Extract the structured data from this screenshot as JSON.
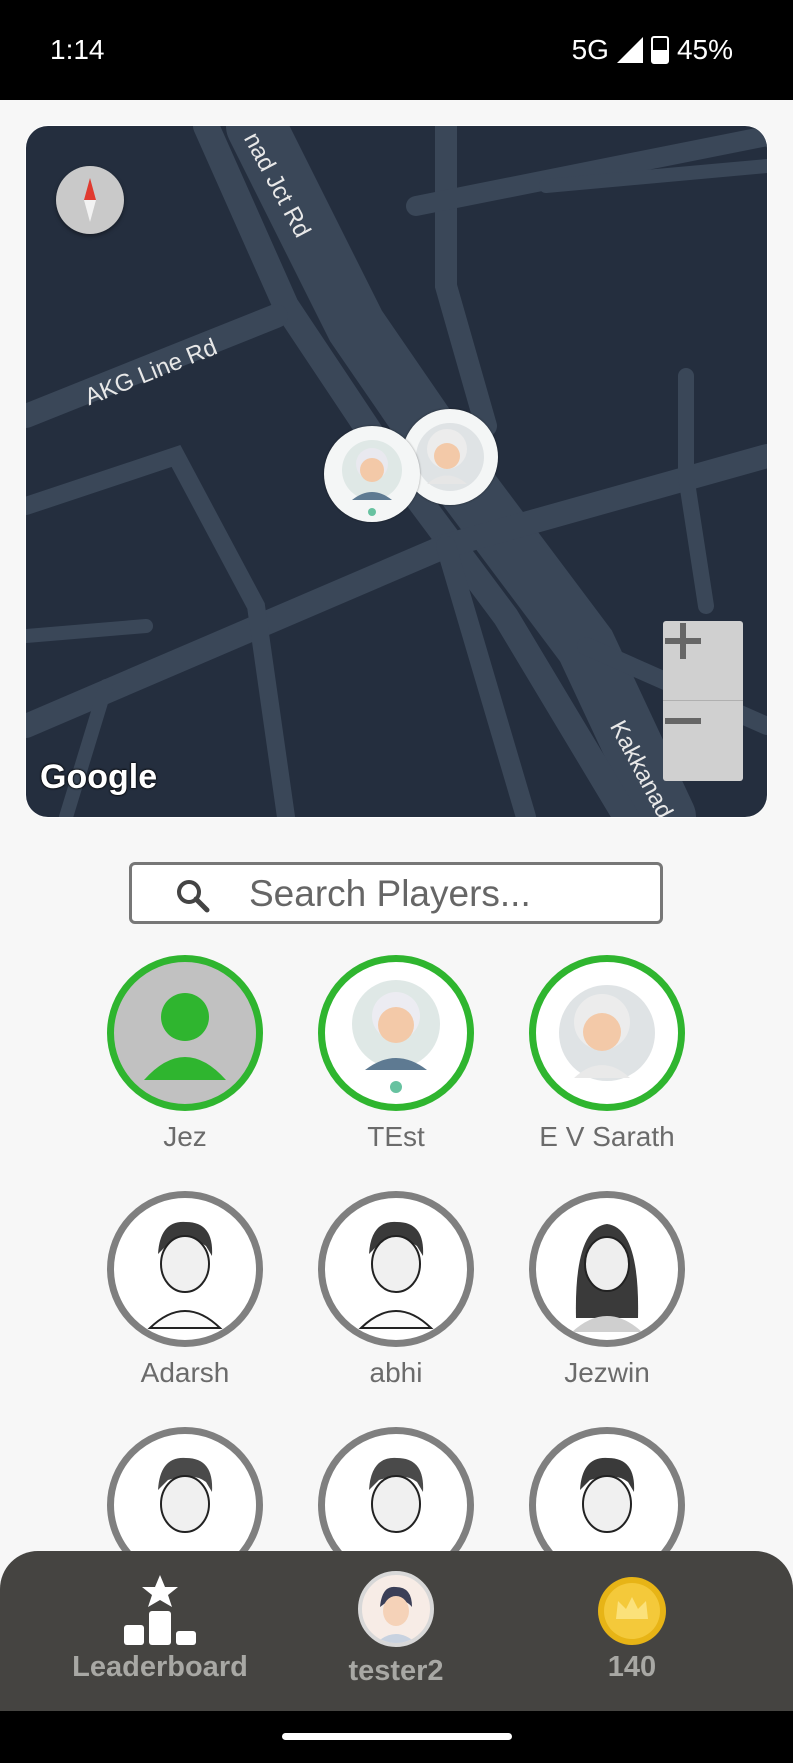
{
  "status_bar": {
    "time": "1:14",
    "network": "5G",
    "battery": "45%"
  },
  "map": {
    "road_labels": [
      "nad Jct Rd",
      "AKG Line Rd",
      "Kakkanad"
    ],
    "attribution": "Google",
    "zoom_in": "+",
    "zoom_out": "−"
  },
  "search": {
    "placeholder": "Search Players...",
    "value": ""
  },
  "players": [
    {
      "name": "Jez",
      "online": true,
      "avatar": "default-silhouette-icon"
    },
    {
      "name": "TEst",
      "online": true,
      "avatar": "old-man-avatar"
    },
    {
      "name": "E V Sarath",
      "online": true,
      "avatar": "old-woman-avatar"
    },
    {
      "name": "Adarsh",
      "online": false,
      "avatar": "sketch-man-avatar"
    },
    {
      "name": "abhi",
      "online": false,
      "avatar": "sketch-man-avatar"
    },
    {
      "name": "Jezwin",
      "online": false,
      "avatar": "sketch-woman-avatar"
    },
    {
      "name": "",
      "online": false,
      "avatar": "sketch-man-avatar"
    },
    {
      "name": "",
      "online": false,
      "avatar": "sketch-man-avatar"
    },
    {
      "name": "",
      "online": false,
      "avatar": "sketch-man-avatar"
    }
  ],
  "bottom_nav": {
    "leaderboard_label": "Leaderboard",
    "profile_label": "tester2",
    "coins_label": "140"
  },
  "colors": {
    "online_ring": "#2fb52f",
    "offline_ring": "#7f7f7f",
    "bottom_bar": "#454441",
    "map_bg": "#242e3e"
  }
}
